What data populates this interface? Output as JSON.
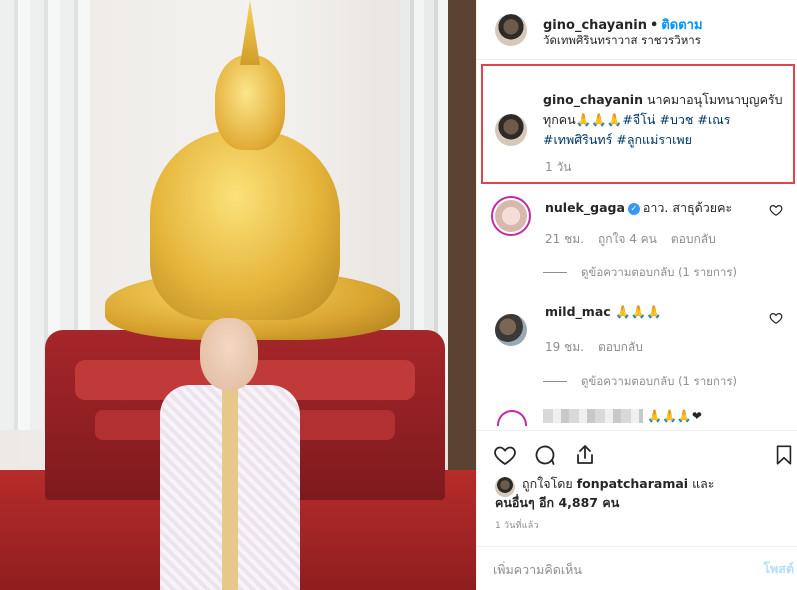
{
  "header": {
    "username": "gino_chayanin",
    "dot": "•",
    "follow_label": "ติดตาม",
    "location": "วัดเทพศิรินทราวาส ราชวรวิหาร"
  },
  "caption": {
    "username": "gino_chayanin",
    "text": "นาคมาอนุโมทนาบุญครับทุกคน🙏🙏🙏",
    "hashtags": [
      "#จีโน่",
      "#บวช",
      "#เณร",
      "#เทพศิรินทร์",
      "#ลูกแม่ราเพย"
    ],
    "time": "1 วัน"
  },
  "comments": [
    {
      "username": "nulek_gaga",
      "verified": "✓",
      "text": "อาว. สาธุด้วยคะ",
      "time": "21 ชม.",
      "likes": "ถูกใจ 4 คน",
      "reply_label": "ตอบกลับ",
      "view_replies": "ดูข้อความตอบกลับ (1 รายการ)"
    },
    {
      "username": "mild_mac",
      "text": "🙏🙏🙏",
      "time": "19 ชม.",
      "reply_label": "ตอบกลับ",
      "view_replies": "ดูข้อความตอบกลับ (1 รายการ)"
    },
    {
      "text": "🙏🙏🙏❤"
    }
  ],
  "likes": {
    "prefix": "ถูกใจโดย",
    "user": "fonpatcharamai",
    "and": "และ",
    "others": "คนอื่นๆ อีก 4,887 คน"
  },
  "post_time": "1 วันที่แล้ว",
  "add_comment": {
    "placeholder": "เพิ่มความคิดเห็น",
    "post_label": "โพสต์"
  },
  "icons": {
    "like": "heart-icon",
    "comment": "comment-icon",
    "share": "share-icon",
    "save": "bookmark-icon"
  }
}
